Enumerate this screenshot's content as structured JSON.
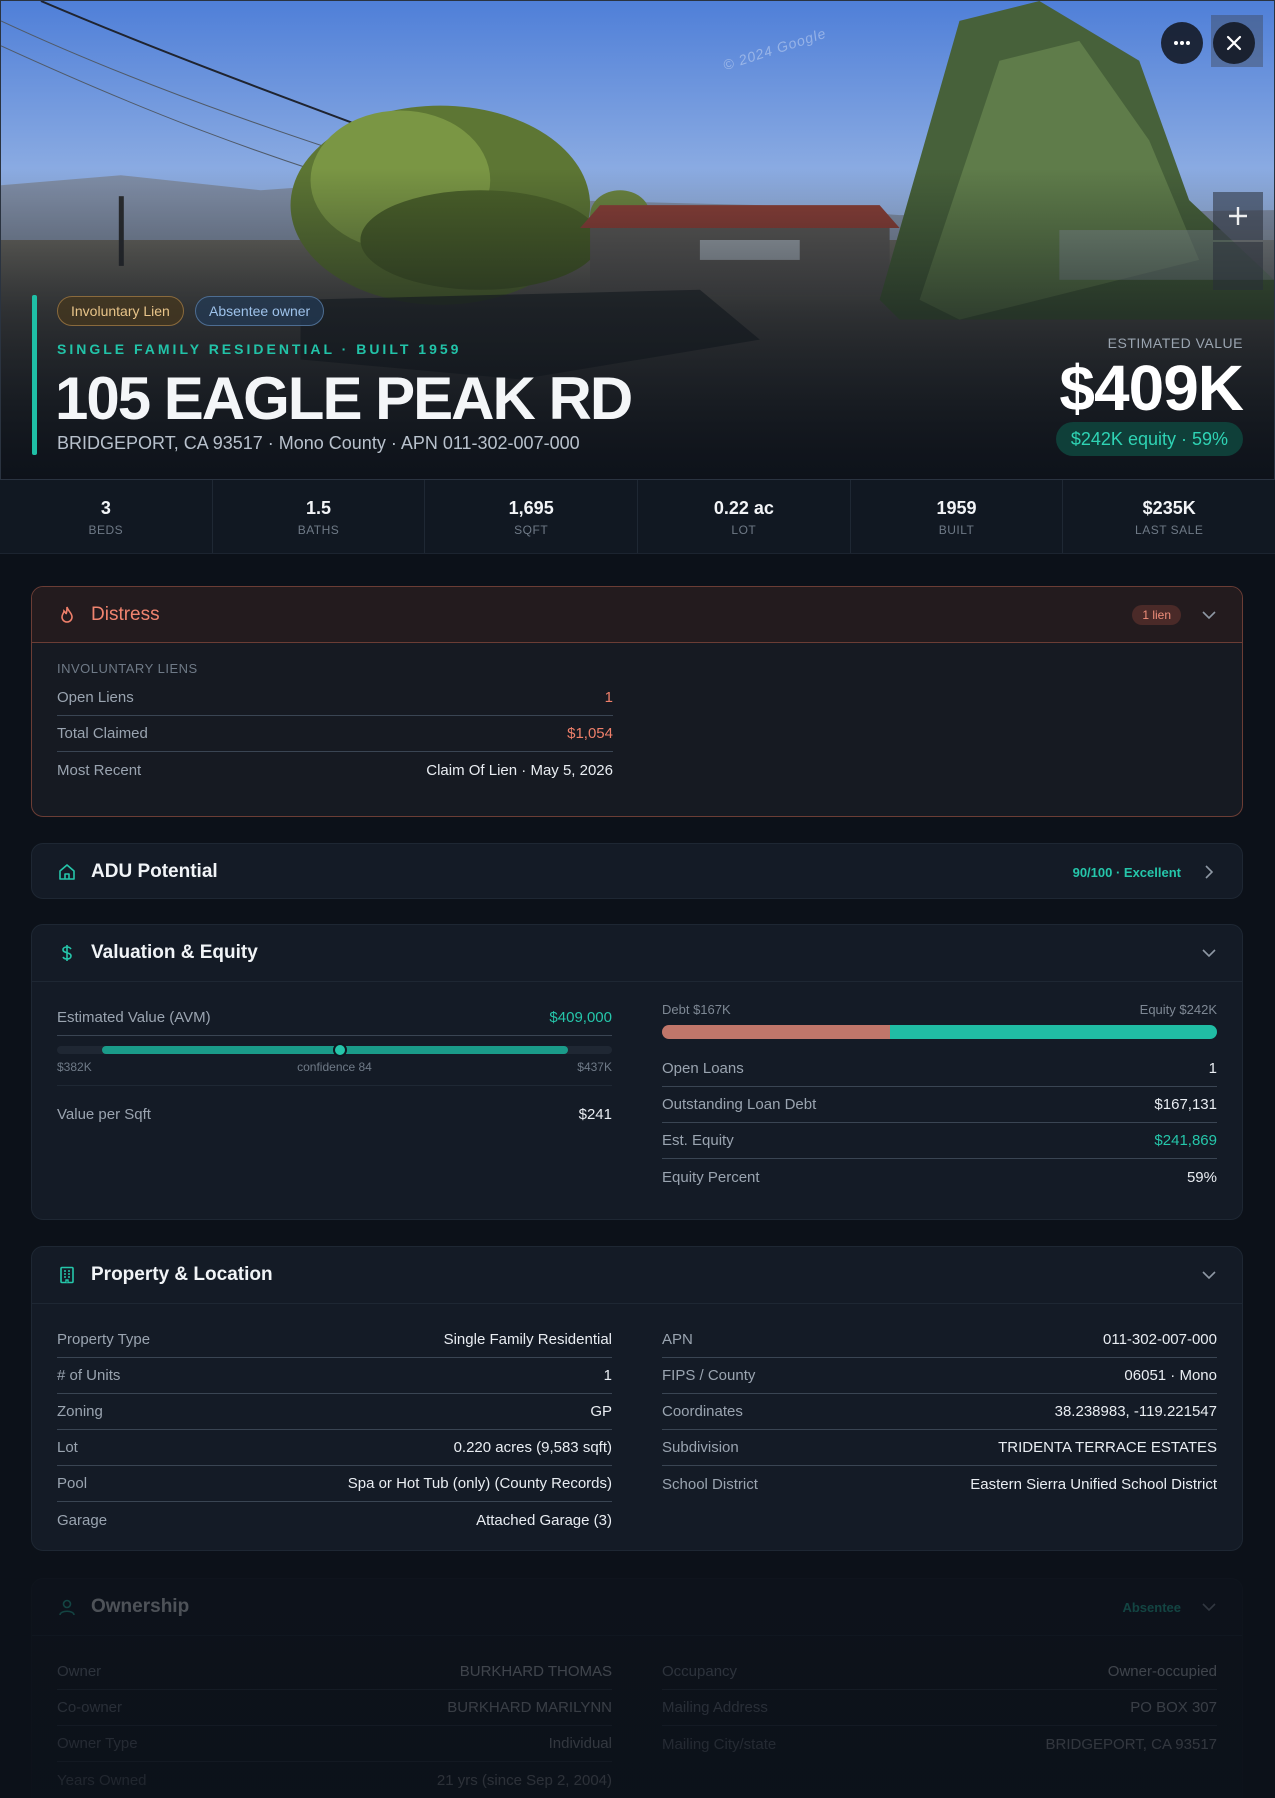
{
  "hero": {
    "watermark": "© 2024 Google",
    "badges": [
      "Involuntary Lien",
      "Absentee owner"
    ],
    "subtitle": "SINGLE FAMILY RESIDENTIAL · BUILT 1959",
    "address": "105 EAGLE PEAK RD",
    "location": "BRIDGEPORT, CA 93517 · Mono County · APN 011-302-007-000",
    "estimate_label": "ESTIMATED VALUE",
    "estimate_value": "$409K",
    "equity_pill": "$242K equity · 59%",
    "icons": {
      "more": "more-horizontal-icon",
      "close": "close-icon",
      "zoom_in": "plus-icon"
    }
  },
  "stats": [
    {
      "value": "3",
      "label": "BEDS"
    },
    {
      "value": "1.5",
      "label": "BATHS"
    },
    {
      "value": "1,695",
      "label": "SQFT"
    },
    {
      "value": "0.22 ac",
      "label": "LOT"
    },
    {
      "value": "1959",
      "label": "BUILT"
    },
    {
      "value": "$235K",
      "label": "LAST SALE"
    }
  ],
  "distress": {
    "title": "Distress",
    "badge": "1 lien",
    "section": "INVOLUNTARY LIENS",
    "rows": [
      {
        "k": "Open Liens",
        "v": "1"
      },
      {
        "k": "Total Claimed",
        "v": "$1,054"
      },
      {
        "k": "Most Recent",
        "v": "Claim Of Lien · May 5, 2026"
      }
    ]
  },
  "adu": {
    "title": "ADU Potential",
    "score": "90/100 · Excellent"
  },
  "valuation": {
    "title": "Valuation & Equity",
    "avm_label": "Estimated Value (AVM)",
    "avm_value": "$409,000",
    "avm_low": "$382K",
    "avm_confidence": "confidence 84",
    "avm_high": "$437K",
    "per_sqft_label": "Value per Sqft",
    "per_sqft_value": "$241",
    "debt_label": "Debt $167K",
    "equity_label": "Equity $242K",
    "debt_fraction": 0.41,
    "rows": [
      {
        "k": "Open Loans",
        "v": "1"
      },
      {
        "k": "Outstanding Loan Debt",
        "v": "$167,131"
      },
      {
        "k": "Est. Equity",
        "v": "$241,869"
      },
      {
        "k": "Equity Percent",
        "v": "59%"
      }
    ]
  },
  "property": {
    "title": "Property & Location",
    "left": [
      {
        "k": "Property Type",
        "v": "Single Family Residential"
      },
      {
        "k": "# of Units",
        "v": "1"
      },
      {
        "k": "Zoning",
        "v": "GP"
      },
      {
        "k": "Lot",
        "v": "0.220 acres (9,583 sqft)"
      },
      {
        "k": "Pool",
        "v": "Spa or Hot Tub (only) (County Records)"
      },
      {
        "k": "Garage",
        "v": "Attached Garage (3)"
      }
    ],
    "right": [
      {
        "k": "APN",
        "v": "011-302-007-000"
      },
      {
        "k": "FIPS / County",
        "v": "06051 · Mono"
      },
      {
        "k": "Coordinates",
        "v": "38.238983, -119.221547"
      },
      {
        "k": "Subdivision",
        "v": "TRIDENTA TERRACE ESTATES"
      },
      {
        "k": "School District",
        "v": "Eastern Sierra Unified School District"
      }
    ]
  },
  "ownership": {
    "title": "Ownership",
    "tag": "Absentee",
    "left": [
      {
        "k": "Owner",
        "v": "BURKHARD THOMAS"
      },
      {
        "k": "Co-owner",
        "v": "BURKHARD MARILYNN"
      },
      {
        "k": "Owner Type",
        "v": "Individual"
      },
      {
        "k": "Years Owned",
        "v": "21 yrs (since Sep 2, 2004)"
      }
    ],
    "right": [
      {
        "k": "Occupancy",
        "v": "Owner-occupied"
      },
      {
        "k": "Mailing Address",
        "v": "PO BOX 307"
      },
      {
        "k": "Mailing City/state",
        "v": "BRIDGEPORT, CA 93517"
      }
    ]
  }
}
